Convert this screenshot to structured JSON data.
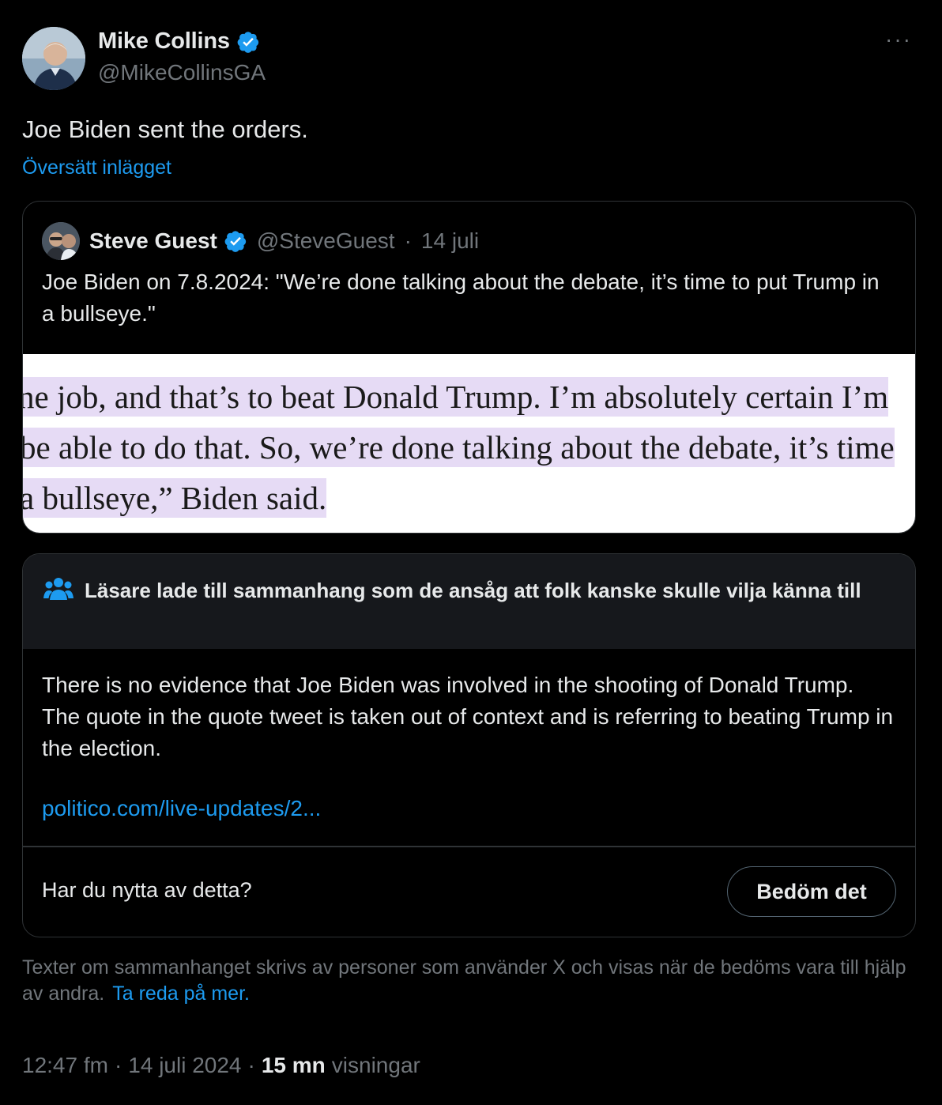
{
  "author": {
    "display_name": "Mike Collins",
    "handle": "@MikeCollinsGA",
    "verified": true
  },
  "more_menu": "···",
  "tweet": {
    "text": "Joe Biden sent the orders.",
    "translate_label": "Översätt inlägget"
  },
  "quoted": {
    "display_name": "Steve Guest",
    "handle": "@SteveGuest",
    "separator": "·",
    "date": "14 juli",
    "text": "Joe Biden on 7.8.2024: \"We’re done talking about the debate, it’s time to put Trump in a bullseye.\"",
    "image_lines": [
      "ne job, and that’s to beat Donald Trump. I’m absolutely certain I’m",
      " be able to do that. So, we’re done talking about the debate, it’s time",
      " a bullseye,” Biden said."
    ]
  },
  "community_note": {
    "title": "Läsare lade till sammanhang som de ansåg att folk kanske skulle vilja känna till",
    "body": "There is no evidence that Joe Biden was involved in the shooting of Donald Trump. The quote in the quote tweet is taken out of context and is referring to beating Trump in the election.",
    "link": "politico.com/live-updates/2...",
    "helpful_question": "Har du nytta av detta?",
    "rate_button": "Bedöm det"
  },
  "disclaimer": {
    "text": "Texter om sammanhanget skrivs av personer som använder X och visas när de bedöms vara till hjälp av andra.",
    "learn_more": "Ta reda på mer."
  },
  "meta": {
    "time": "12:47 fm",
    "separator": "·",
    "date": "14 juli 2024",
    "views_count": "15 mn",
    "views_label": "visningar"
  },
  "colors": {
    "background": "#000000",
    "text": "#e7e9ea",
    "secondary": "#71767b",
    "accent": "#1d9bf0",
    "border": "#2f3336",
    "highlight": "#e6dbf5"
  }
}
